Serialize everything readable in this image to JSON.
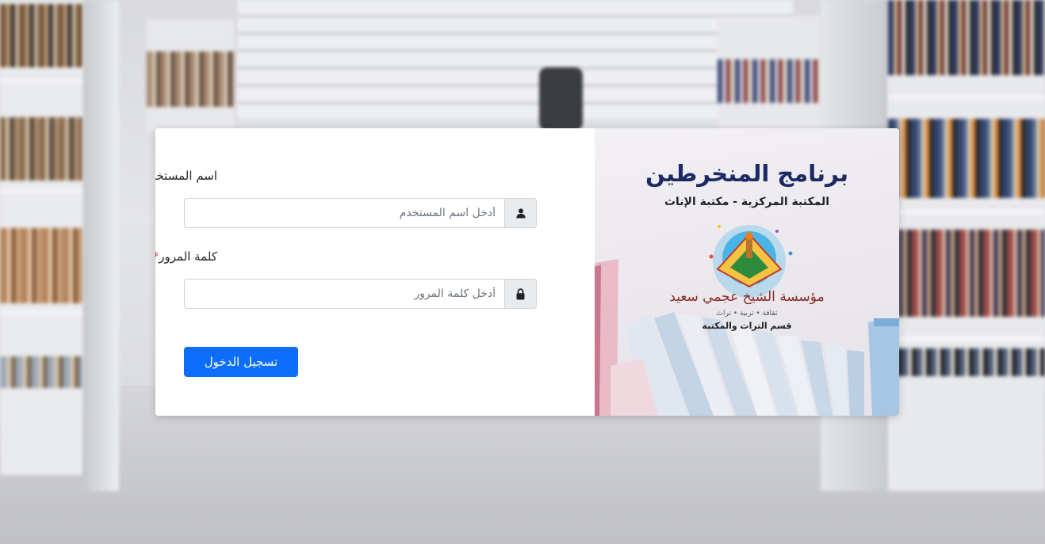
{
  "login": {
    "username_label": "اسم المستخدم",
    "username_placeholder": "أدخل اسم المستخدم",
    "username_value": "",
    "password_label": "كلمة المرور",
    "password_placeholder": "أدخل كلمة المرور",
    "password_value": "",
    "required_mark": "*",
    "submit_label": "تسجيل الدخول",
    "username_icon": "user-icon",
    "password_icon": "lock-icon"
  },
  "brand": {
    "program_title": "برنامج المنخرطين",
    "program_subtitle": "المكتبة المركزية - مكتبة الإناث",
    "logo_name": "مؤسسة الشيخ عجمي سعيد",
    "logo_tagline": "ثقافة • تربية • تراث",
    "logo_department": "قسم التراث والمكتبة"
  },
  "colors": {
    "primary": "#0d6efd",
    "required": "#dc3545",
    "title": "#1c2a63"
  }
}
